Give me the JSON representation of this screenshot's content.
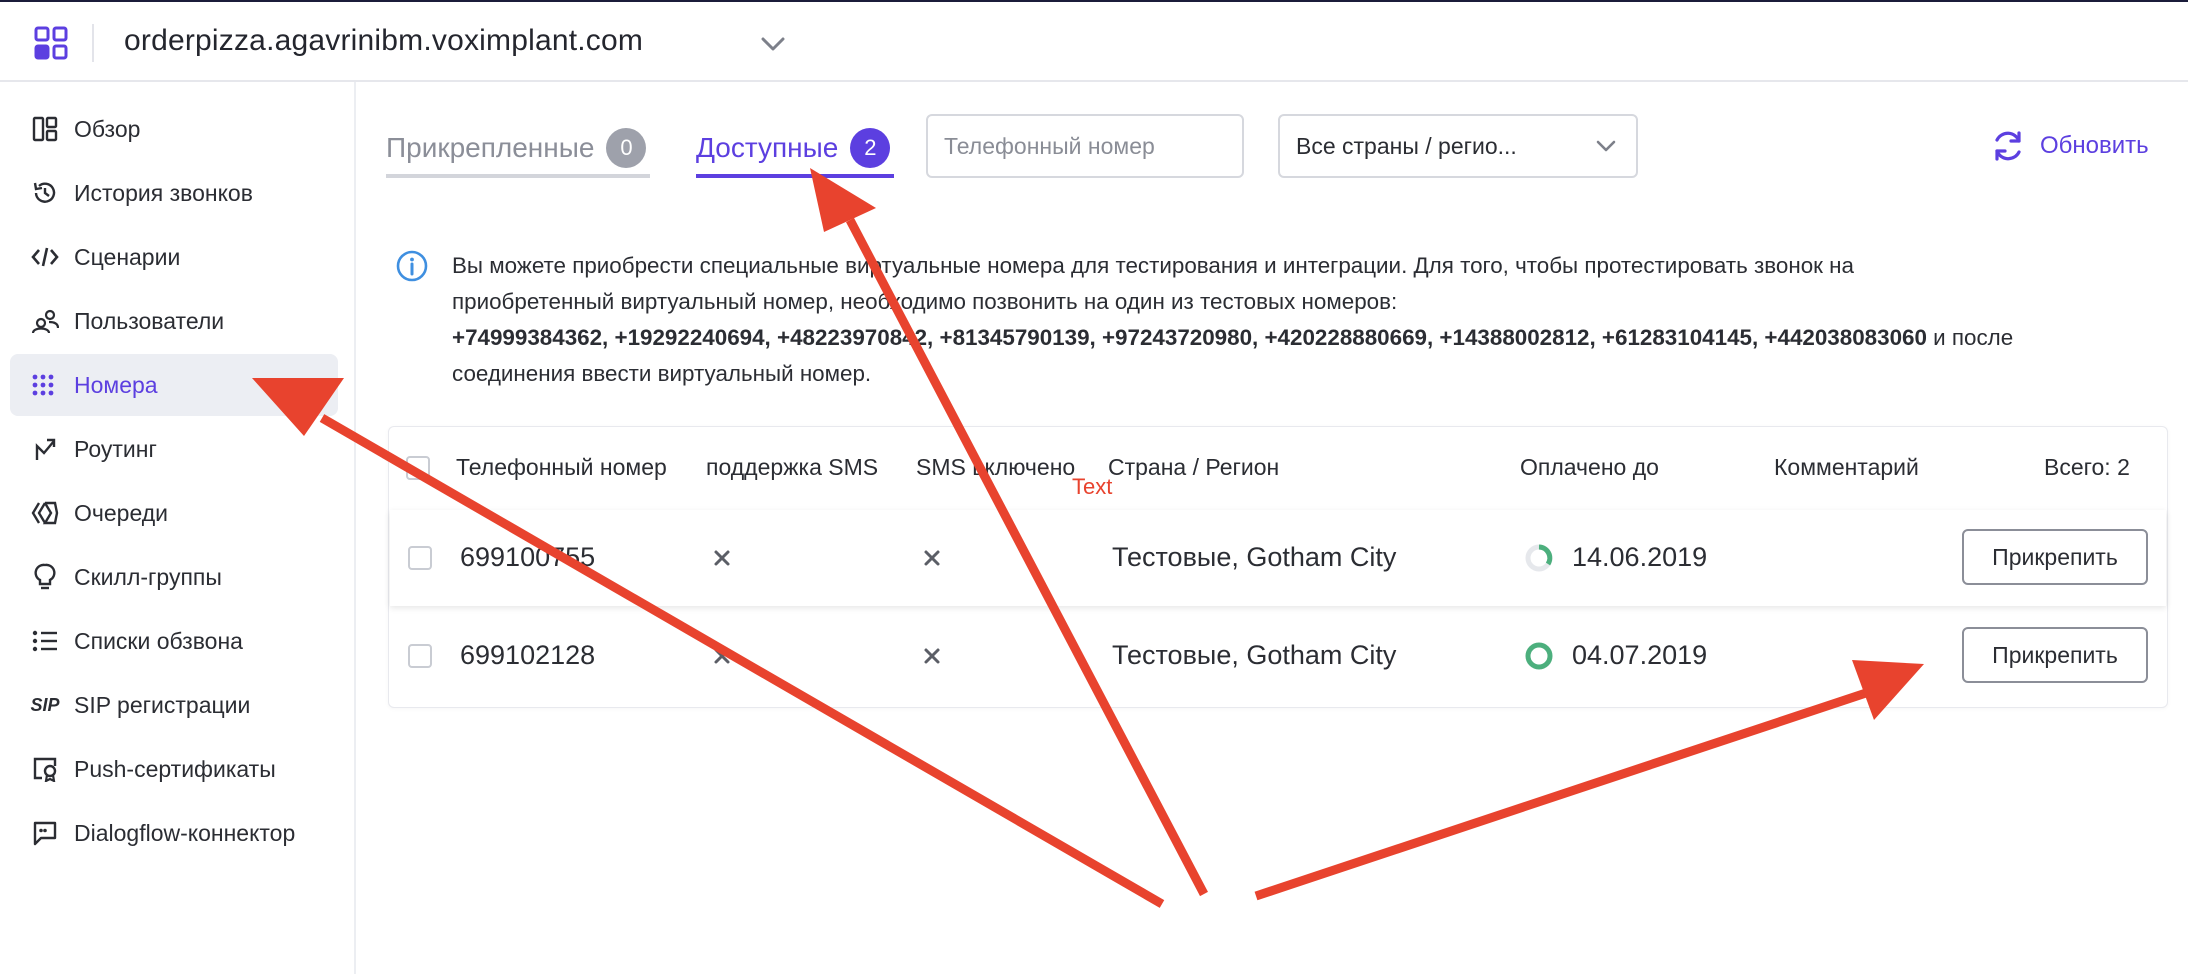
{
  "header": {
    "domain": "orderpizza.agavrinibm.voximplant.com"
  },
  "sidebar": {
    "items": [
      {
        "label": "Обзор",
        "icon": "overview-icon"
      },
      {
        "label": "История звонков",
        "icon": "history-icon"
      },
      {
        "label": "Сценарии",
        "icon": "code-icon"
      },
      {
        "label": "Пользователи",
        "icon": "users-icon"
      },
      {
        "label": "Номера",
        "icon": "dialpad-icon",
        "active": true
      },
      {
        "label": "Роутинг",
        "icon": "routing-icon"
      },
      {
        "label": "Очереди",
        "icon": "queues-icon"
      },
      {
        "label": "Скилл-группы",
        "icon": "bulb-icon"
      },
      {
        "label": "Списки обзвона",
        "icon": "list-icon"
      },
      {
        "label": "SIP регистрации",
        "icon": "sip-icon"
      },
      {
        "label": "Push-сертификаты",
        "icon": "certificate-icon"
      },
      {
        "label": "Dialogflow-коннектор",
        "icon": "chat-icon"
      }
    ]
  },
  "tabs": {
    "attached": {
      "label": "Прикрепленные",
      "count": "0"
    },
    "available": {
      "label": "Доступные",
      "count": "2"
    }
  },
  "filters": {
    "phone_placeholder": "Телефонный номер",
    "phone_value": "",
    "country_value": "Все страны / регио..."
  },
  "refresh_label": "Обновить",
  "info": {
    "line1": "Вы можете приобрести специальные виртуальные номера для тестирования и интеграции. Для того, чтобы протестировать звонок на",
    "line2": "приобретенный виртуальный номер, необходимо позвонить на один из тестовых номеров:",
    "numbers": "+74999384362, +19292240694, +48223970842, +81345790139, +97243720980, +420228880669, +14388002812, +61283104145, +442038083060",
    "after_numbers": " и после",
    "line4": "соединения ввести виртуальный номер."
  },
  "table": {
    "headers": {
      "phone": "Телефонный номер",
      "sms_support": "поддержка SMS",
      "sms_enabled": "SMS включено",
      "country": "Страна / Регион",
      "paid_until": "Оплачено до",
      "comment": "Комментарий",
      "total": "Всего: 2"
    },
    "rows": [
      {
        "phone": "699100755",
        "country": "Тестовые, Gotham City",
        "paid_until": "14.06.2019",
        "button": "Прикрепить"
      },
      {
        "phone": "699102128",
        "country": "Тестовые, Gotham City",
        "paid_until": "04.07.2019",
        "button": "Прикрепить"
      }
    ]
  },
  "annotation": {
    "text": "Text",
    "color": "#e8432e"
  },
  "colors": {
    "accent": "#5c3fe0",
    "status_green": "#4caf7d"
  }
}
